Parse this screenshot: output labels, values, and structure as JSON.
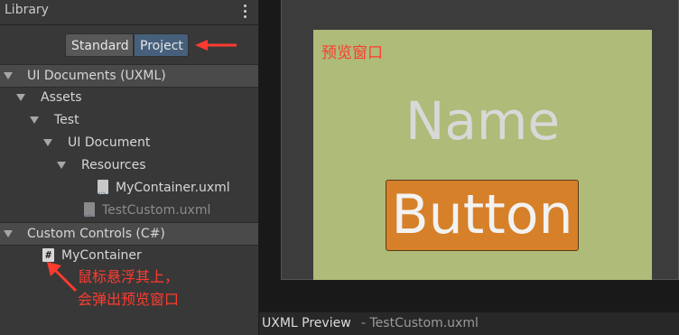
{
  "library": {
    "title": "Library",
    "toggle": {
      "standard": "Standard",
      "project": "Project"
    },
    "tree": [
      {
        "label": "UI Documents (UXML)"
      },
      {
        "label": "Assets"
      },
      {
        "label": "Test"
      },
      {
        "label": "UI Document"
      },
      {
        "label": "Resources"
      },
      {
        "label": "MyContainer.uxml"
      },
      {
        "label": "TestCustom.uxml"
      },
      {
        "label": "Custom Controls (C#)"
      },
      {
        "label": "MyContainer"
      }
    ]
  },
  "annotations": {
    "preview_window": "预览窗口",
    "hover_note_line1": "鼠标悬浮其上，",
    "hover_note_line2": "会弹出预览窗口",
    "color": "#ff3b2f"
  },
  "preview": {
    "name_label": "Name",
    "button_label": "Button",
    "background_color": "#aebb79",
    "button_color": "#d6802a"
  },
  "footer": {
    "title": "UXML Preview",
    "subtitle": "- TestCustom.uxml"
  }
}
